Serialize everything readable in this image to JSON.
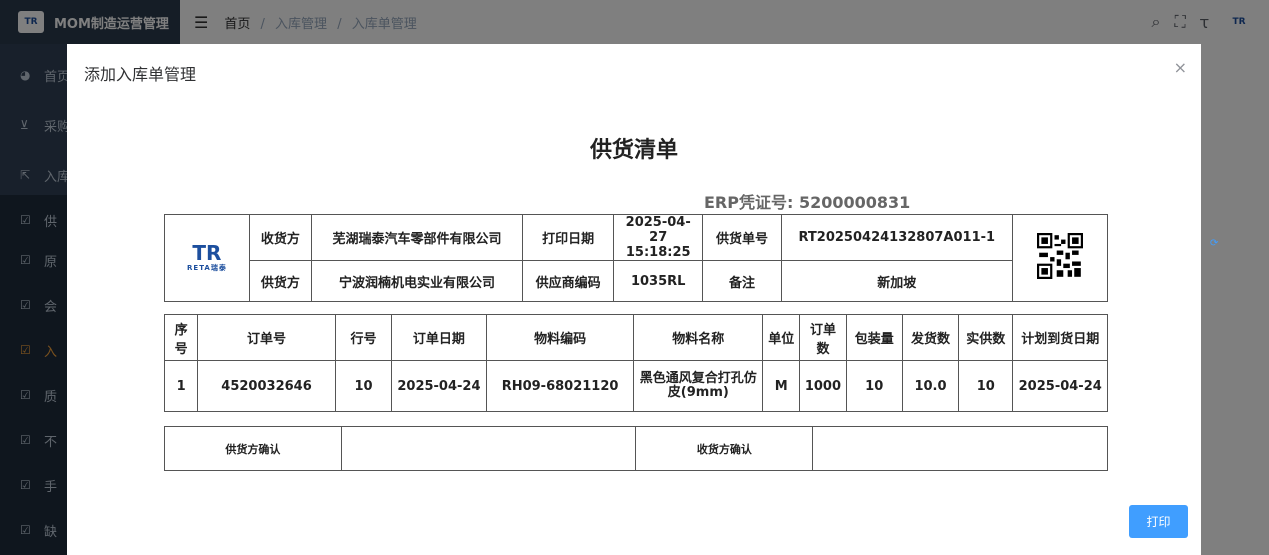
{
  "app": {
    "title": "MOM制造运营管理",
    "logo_text": "TR",
    "breadcrumb": [
      "首页",
      "入库管理",
      "入库单管理"
    ],
    "breadcrumb_sep": "/"
  },
  "sidebar": {
    "items": [
      {
        "label": "首页",
        "icon": "dashboard-icon"
      },
      {
        "label": "采购",
        "icon": "cart-icon"
      },
      {
        "label": "入库",
        "icon": "external-link-icon"
      },
      {
        "label": "供",
        "icon": "checkbox-icon"
      },
      {
        "label": "原",
        "icon": "checkbox-icon"
      },
      {
        "label": "会",
        "icon": "checkbox-icon"
      },
      {
        "label": "入",
        "icon": "checkbox-icon"
      },
      {
        "label": "质",
        "icon": "checkbox-icon"
      },
      {
        "label": "不",
        "icon": "checkbox-icon"
      },
      {
        "label": "手",
        "icon": "checkbox-icon"
      },
      {
        "label": "缺",
        "icon": "checkbox-icon"
      }
    ]
  },
  "dialog": {
    "title": "添加入库单管理",
    "close_glyph": "×",
    "print_label": "打印"
  },
  "doc": {
    "title": "供货清单",
    "erp": "ERP凭证号: 5200000831",
    "logo_big": "TR",
    "logo_small": "RETA瑞泰",
    "header": {
      "receiver_label": "收货方",
      "receiver": "芜湖瑞泰汽车零部件有限公司",
      "print_date_label": "打印日期",
      "print_date": "2025-04-27",
      "print_time": "15:18:25",
      "supply_no_label": "供货单号",
      "supply_no": "RT20250424132807A011-1",
      "supplier_label": "供货方",
      "supplier": "宁波润楠机电实业有限公司",
      "supplier_code_label": "供应商编码",
      "supplier_code": "1035RL",
      "remark_label": "备注",
      "remark": "新加坡"
    },
    "columns": [
      "序号",
      "订单号",
      "行号",
      "订单日期",
      "物料编码",
      "物料名称",
      "单位",
      "订单数",
      "包装量",
      "发货数",
      "实供数",
      "计划到货日期"
    ],
    "rows": [
      [
        "1",
        "4520032646",
        "10",
        "2025-04-24",
        "RH09-68021120",
        "黑色通风复合打孔仿皮(9mm)",
        "M",
        "1000",
        "10",
        "10.0",
        "10",
        "2025-04-24"
      ]
    ],
    "confirm": {
      "supplier_confirm": "供货方确认",
      "receiver_confirm": "收货方确认"
    }
  },
  "colors": {
    "sidebar_bg": "#304156",
    "accent": "#409eff",
    "active_menu": "#f4a23b"
  }
}
